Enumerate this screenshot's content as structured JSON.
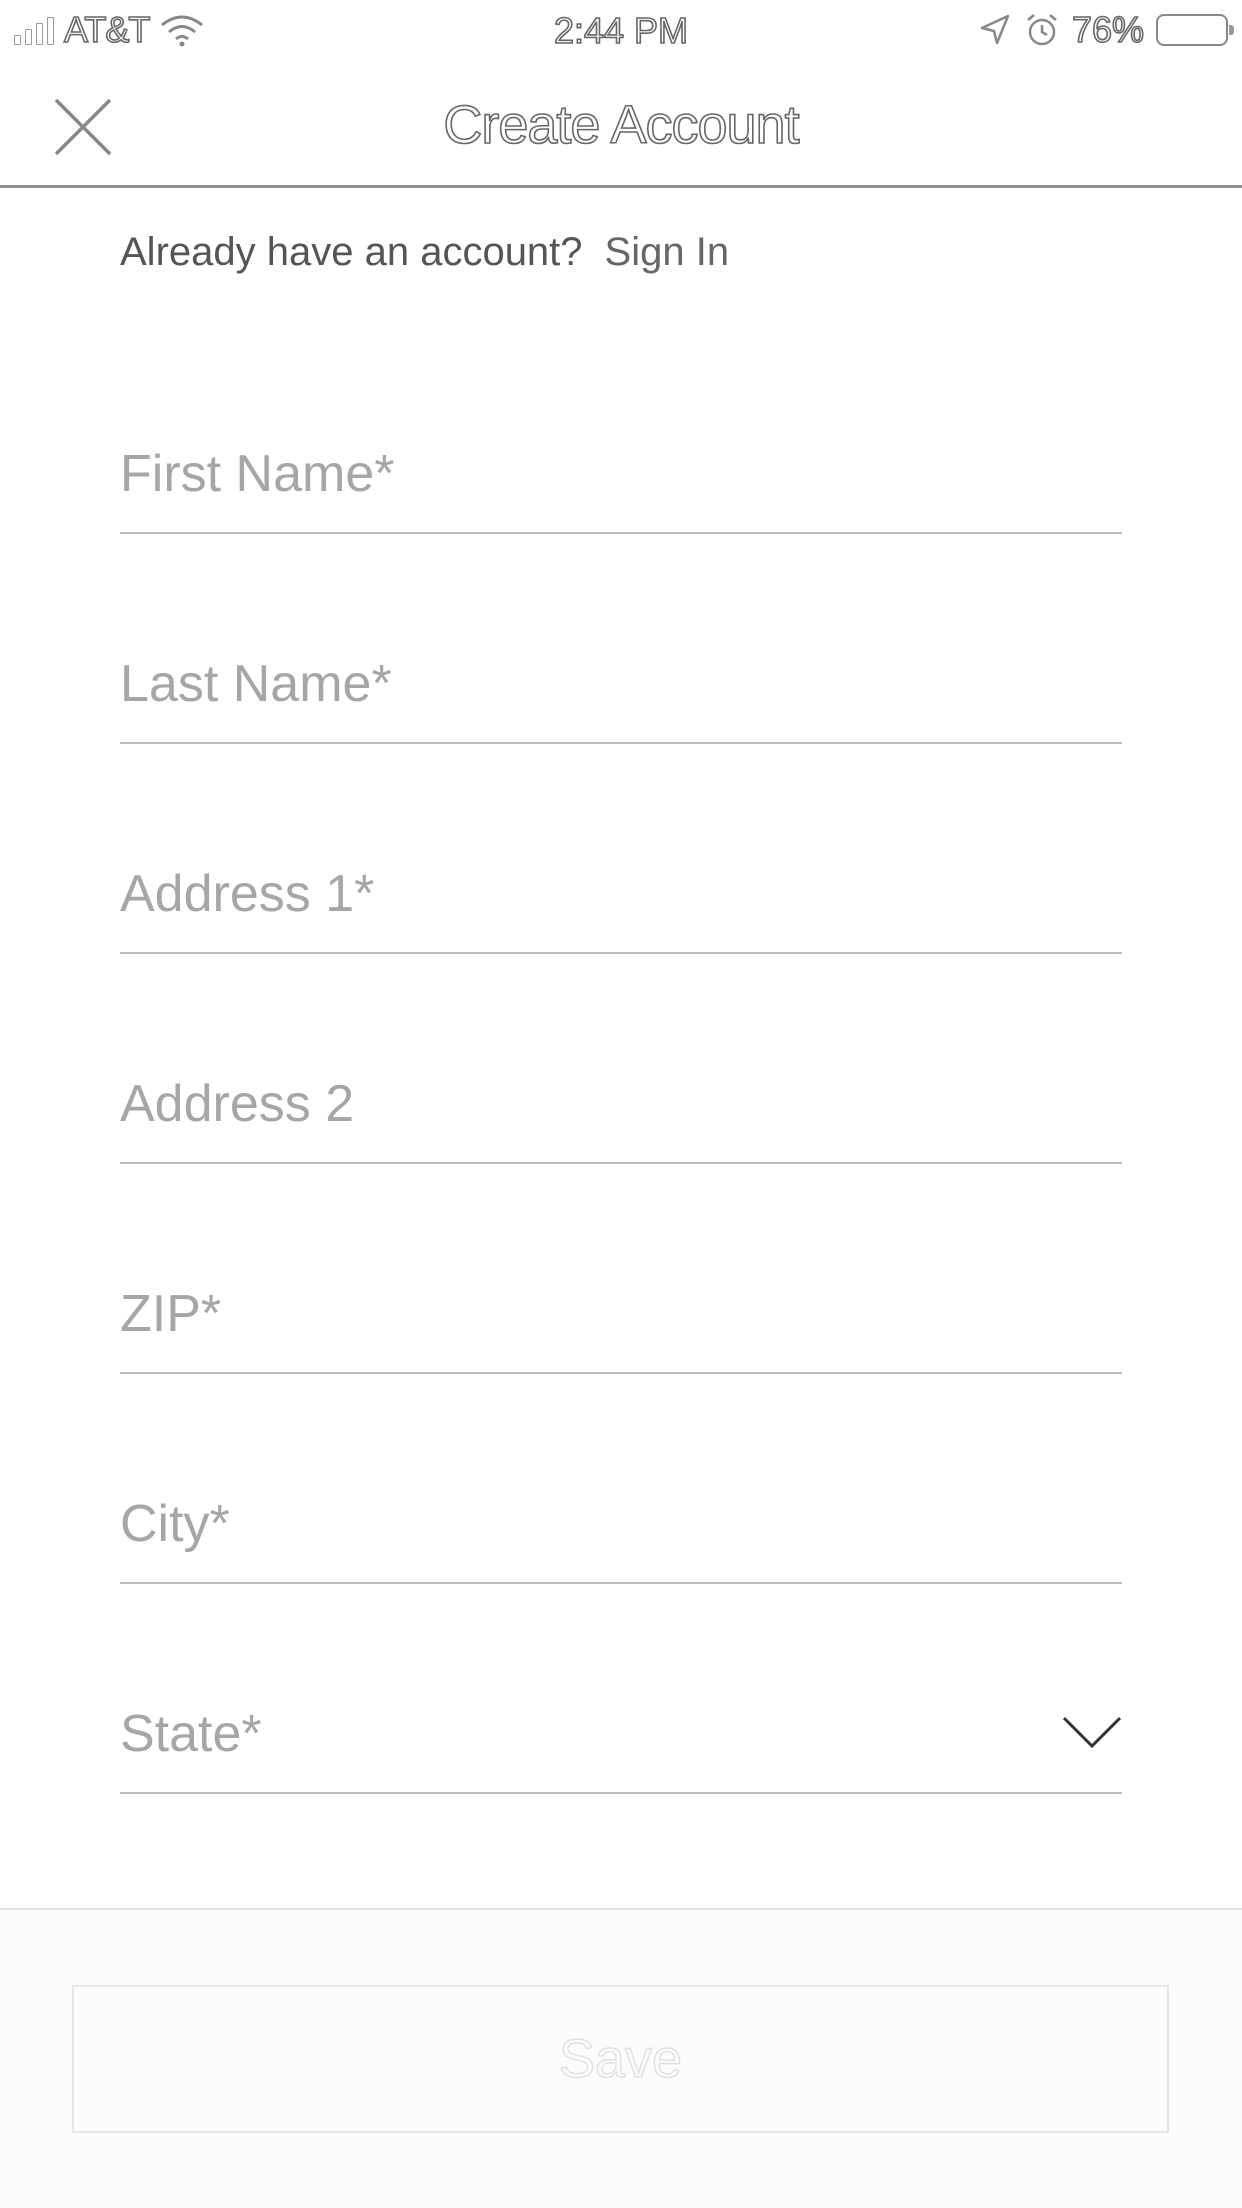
{
  "status_bar": {
    "carrier": "AT&T",
    "time": "2:44 PM",
    "battery_percent": "76%",
    "battery_level": 0.76,
    "icons": [
      "signal-icon",
      "wifi-icon",
      "location-arrow-icon",
      "alarm-icon",
      "battery-icon"
    ]
  },
  "nav": {
    "title": "Create Account",
    "close_icon": "close-icon"
  },
  "signin": {
    "prompt": "Already have an account?",
    "link": "Sign In"
  },
  "form": {
    "fields": [
      {
        "placeholder": "First Name*",
        "value": ""
      },
      {
        "placeholder": "Last Name*",
        "value": ""
      },
      {
        "placeholder": "Address 1*",
        "value": ""
      },
      {
        "placeholder": "Address 2",
        "value": ""
      },
      {
        "placeholder": "ZIP*",
        "value": ""
      },
      {
        "placeholder": "City*",
        "value": ""
      },
      {
        "placeholder": "State*",
        "value": "",
        "icon": "chevron-down-icon"
      }
    ]
  },
  "footer": {
    "save_label": "Save"
  }
}
